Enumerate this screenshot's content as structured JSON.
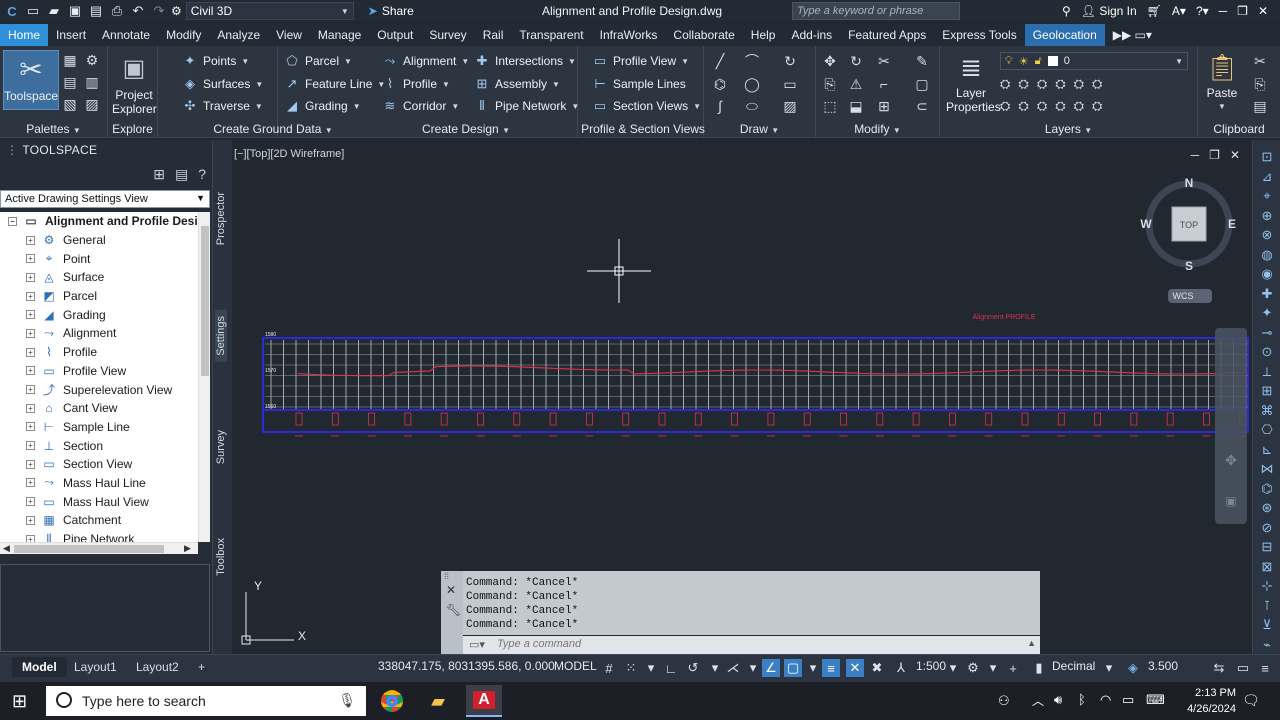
{
  "titlebar": {
    "workspace": "Civil 3D",
    "share": "Share",
    "document_title": "Alignment and Profile Design.dwg",
    "search_placeholder": "Type a keyword or phrase",
    "sign_in": "Sign In"
  },
  "tabs": [
    "Home",
    "Insert",
    "Annotate",
    "Modify",
    "Analyze",
    "View",
    "Manage",
    "Output",
    "Survey",
    "Rail",
    "Transparent",
    "InfraWorks",
    "Collaborate",
    "Help",
    "Add-ins",
    "Featured Apps",
    "Express Tools",
    "Geolocation"
  ],
  "active_tab": "Home",
  "ribbon": {
    "toolspace": "Toolspace",
    "project_explorer_1": "Project",
    "project_explorer_2": "Explorer",
    "palettes": "Palettes",
    "explore": "Explore",
    "ground": {
      "points": "Points",
      "surfaces": "Surfaces",
      "traverse": "Traverse",
      "parcel": "Parcel",
      "feature_line": "Feature Line",
      "grading": "Grading",
      "title": "Create Ground Data"
    },
    "design": {
      "alignment": "Alignment",
      "profile": "Profile",
      "corridor": "Corridor",
      "intersections": "Intersections",
      "assembly": "Assembly",
      "pipe_network": "Pipe Network",
      "title": "Create Design"
    },
    "profile_section": {
      "profile_view": "Profile View",
      "sample_lines": "Sample Lines",
      "section_views": "Section Views",
      "title": "Profile & Section Views"
    },
    "draw": "Draw",
    "modify": "Modify",
    "layers": {
      "layer_properties_1": "Layer",
      "layer_properties_2": "Properties",
      "current_layer": "0",
      "title": "Layers"
    },
    "clipboard": {
      "paste": "Paste",
      "title": "Clipboard"
    }
  },
  "toolspace": {
    "title": "TOOLSPACE",
    "view_select": "Active Drawing Settings View",
    "root": "Alignment and Profile Desi...",
    "items": [
      "General",
      "Point",
      "Surface",
      "Parcel",
      "Grading",
      "Alignment",
      "Profile",
      "Profile View",
      "Superelevation View",
      "Cant View",
      "Sample Line",
      "Section",
      "Section View",
      "Mass Haul Line",
      "Mass Haul View",
      "Catchment",
      "Pipe Network"
    ],
    "side_tabs": [
      "Prospector",
      "Settings",
      "Survey",
      "Toolbox"
    ]
  },
  "viewport": {
    "label": "[−][Top][2D Wireframe]",
    "compass": {
      "n": "N",
      "s": "S",
      "e": "E",
      "w": "W",
      "top": "TOP",
      "wcs": "WCS"
    },
    "profile_title": "Alignment PROFILE",
    "profile_elevations": [
      "1580",
      "1570",
      "1560"
    ],
    "ucs": {
      "x": "X",
      "y": "Y"
    }
  },
  "command_line": {
    "history": [
      "Command: *Cancel*",
      "Command: *Cancel*",
      "Command: *Cancel*",
      "Command: *Cancel*"
    ],
    "placeholder": "Type a command"
  },
  "status_bar": {
    "tabs": [
      "Model",
      "Layout1",
      "Layout2"
    ],
    "coords": "338047.175, 8031395.586, 0.000",
    "mode": "MODEL",
    "scale": "1:500",
    "units": "Decimal",
    "value": "3.500"
  },
  "taskbar": {
    "search": "Type here to search",
    "time": "2:13 PM",
    "date": "4/26/2024"
  },
  "colors": {
    "accent": "#2f8fd8",
    "profile_red": "#e0334a",
    "grid_blue": "#2a2ad8"
  }
}
